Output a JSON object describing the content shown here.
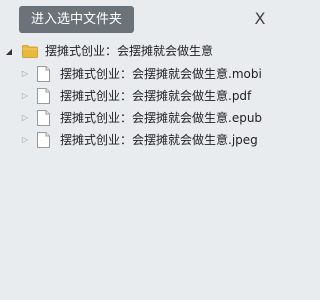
{
  "toolbar": {
    "enter_label": "进入选中文件夹",
    "close_label": "X"
  },
  "tree": {
    "root": {
      "label": "摆摊式创业：会摆摊就会做生意",
      "icon": "folder-icon",
      "expanded": true
    },
    "children": [
      {
        "label": "摆摊式创业：会摆摊就会做生意.mobi",
        "icon": "file-icon"
      },
      {
        "label": "摆摊式创业：会摆摊就会做生意.pdf",
        "icon": "file-icon"
      },
      {
        "label": "摆摊式创业：会摆摊就会做生意.epub",
        "icon": "file-icon"
      },
      {
        "label": "摆摊式创业：会摆摊就会做生意.jpeg",
        "icon": "file-icon"
      }
    ]
  },
  "colors": {
    "background": "#e9ecef",
    "button": "#6b7278",
    "folder": "#e8b93b"
  }
}
